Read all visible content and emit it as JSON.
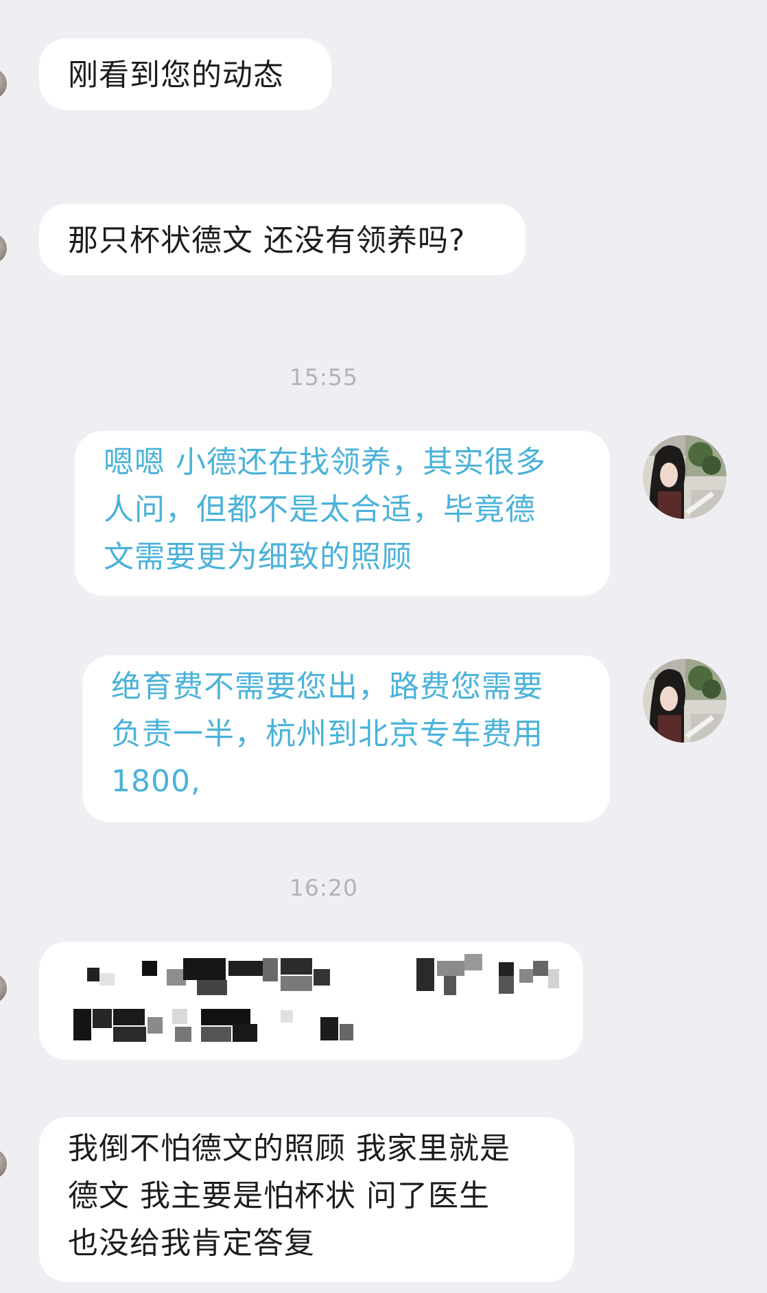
{
  "messages": [
    {
      "lines": [
        "刚看到您的动态"
      ]
    },
    {
      "lines": [
        "那只杯状德文 还没有领养吗?"
      ]
    },
    {
      "lines": [
        "嗯嗯 小德还在找领养，其实很多",
        "人问，但都不是太合适，毕竟德",
        "文需要更为细致的照顾"
      ]
    },
    {
      "lines": [
        "绝育费不需要您出，路费您需要",
        "负责一半，杭州到北京专车费用",
        "1800,"
      ]
    },
    {
      "lines": [
        "我倒不怕德文的照顾 我家里就是",
        "德文 我主要是怕杯状 问了医生",
        "也没给我肯定答复"
      ]
    }
  ],
  "timestamps": [
    "15:55",
    "16:20"
  ],
  "colors": {
    "background": "#efeff3",
    "bubble": "#ffffff",
    "incoming_text": "#1c1c1c",
    "outgoing_text": "#4ab2d9",
    "timestamp_text": "#b3b3b7"
  }
}
